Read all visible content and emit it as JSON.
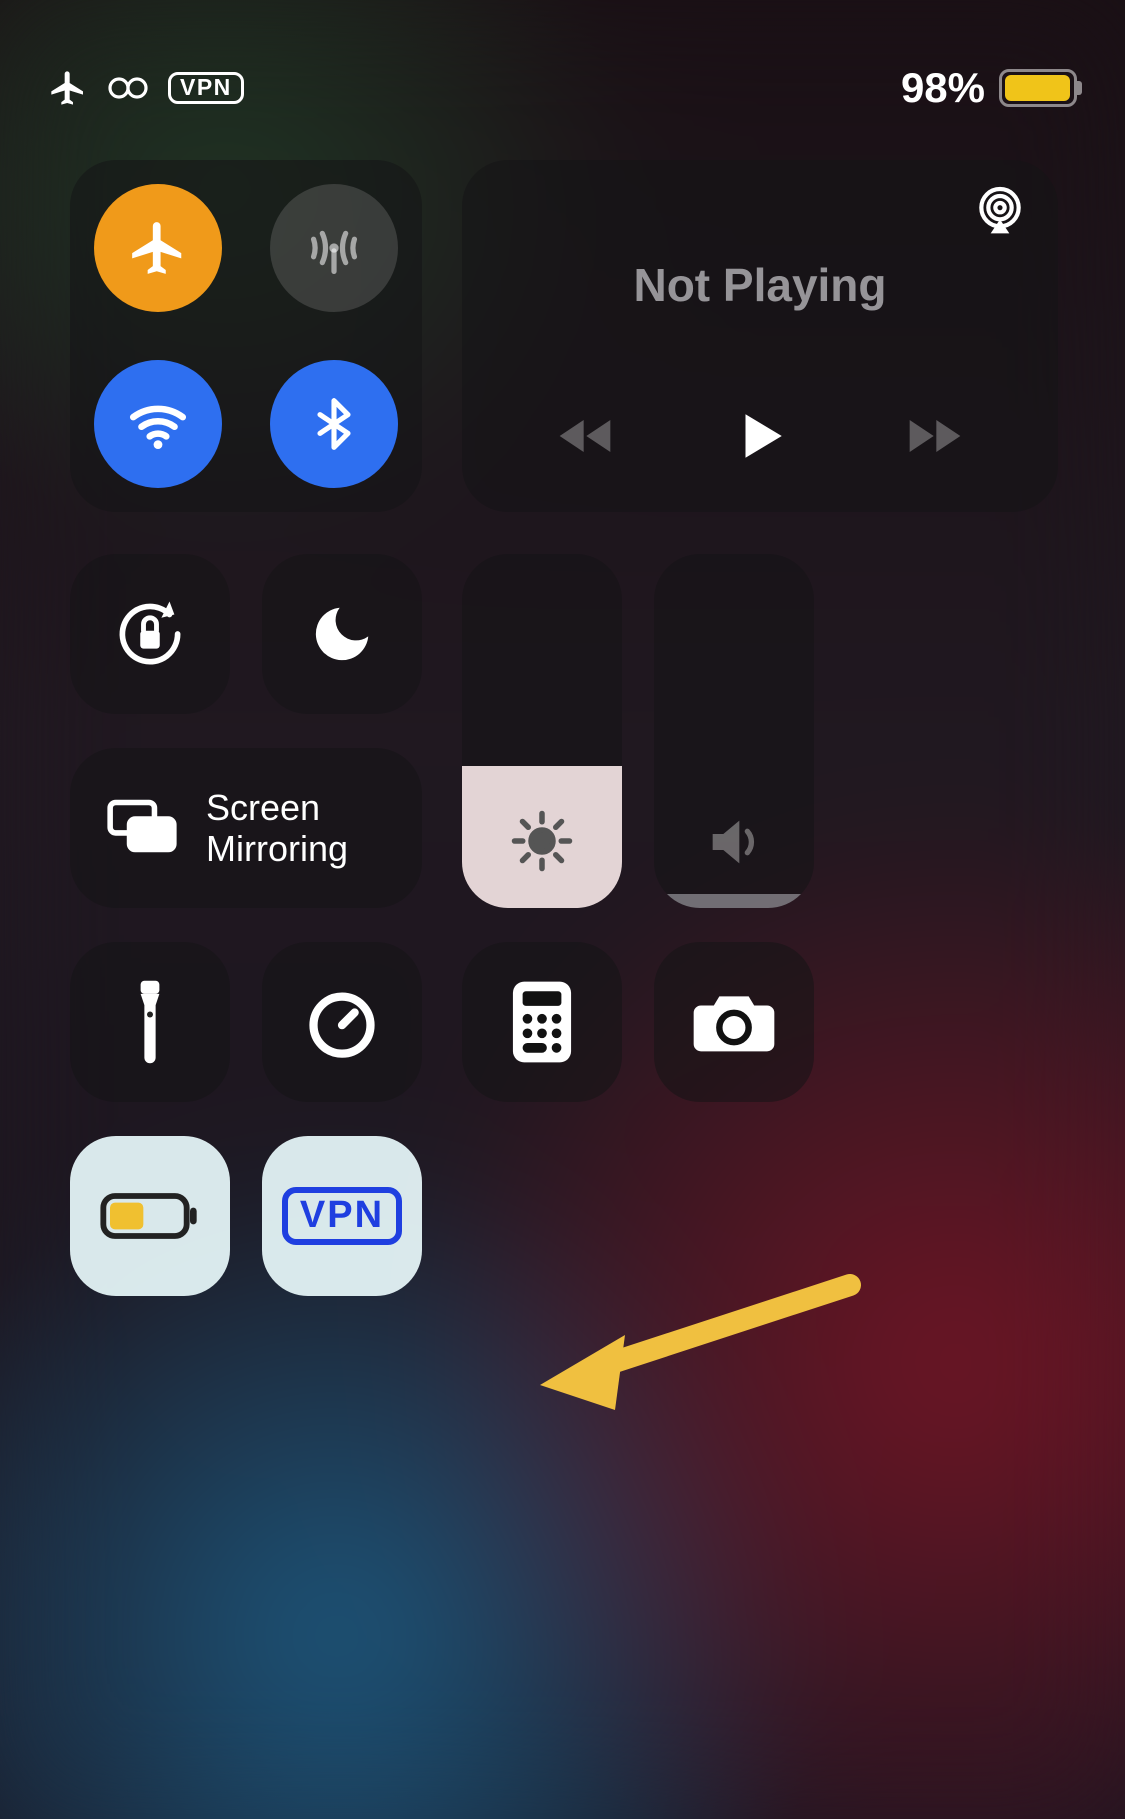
{
  "status": {
    "battery_percent": "98%",
    "battery_level": 0.98,
    "battery_color": "#f0c419",
    "vpn_label": "VPN"
  },
  "media": {
    "title": "Not Playing"
  },
  "mirror": {
    "line1": "Screen",
    "line2": "Mirroring"
  },
  "sliders": {
    "brightness": 0.4,
    "volume": 0.04
  },
  "vpn_tile": {
    "label": "VPN",
    "color": "#1f3fe0"
  },
  "colors": {
    "orange": "#f09a1a",
    "blue": "#2e6ff0",
    "arrow": "#f0c040"
  }
}
